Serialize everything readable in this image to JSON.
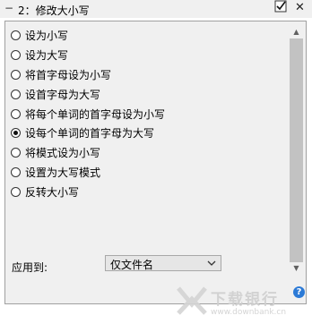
{
  "window": {
    "title": "2：修改大小写",
    "collapse_glyph": "−",
    "close_glyph": "✕",
    "check_icon": "checkbox-checked-icon"
  },
  "options": [
    {
      "label": "设为小写",
      "selected": false
    },
    {
      "label": "设为大写",
      "selected": false
    },
    {
      "label": "将首字母设为小写",
      "selected": false
    },
    {
      "label": "设首字母为大写",
      "selected": false
    },
    {
      "label": "将每个单词的首字母设为小写",
      "selected": false
    },
    {
      "label": "设每个单词的首字母为大写",
      "selected": true
    },
    {
      "label": "将模式设为小写",
      "selected": false
    },
    {
      "label": "设置为大写模式",
      "selected": false
    },
    {
      "label": "反转大小写",
      "selected": false
    }
  ],
  "apply_to": {
    "label": "应用到:",
    "value": "仅文件名"
  },
  "watermark": {
    "text": "下载银行",
    "url": "www.downbank.cn"
  },
  "help": {
    "glyph": "?"
  },
  "colors": {
    "panel_bg": "#f0f0f0",
    "scroll_thumb": "#c2c2c2",
    "help_blue": "#2c7ad6"
  }
}
